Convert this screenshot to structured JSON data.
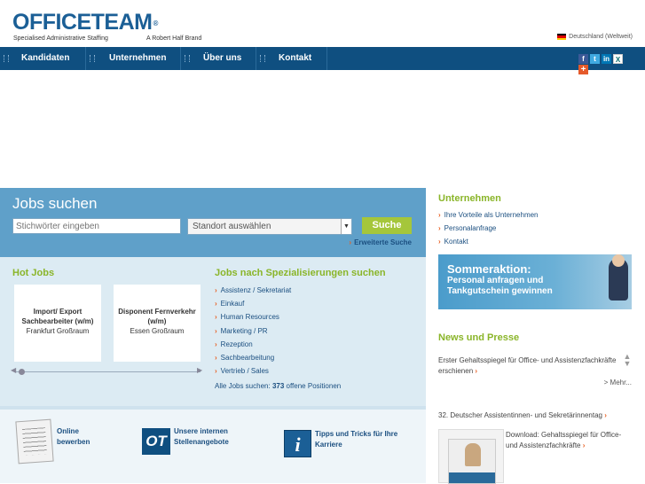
{
  "header": {
    "logo_text": "OFFICETEAM",
    "logo_mark": "®",
    "tagline": "Specialised Administrative Staffing",
    "brand": "A Robert Half Brand",
    "region": "Deutschland (Weltweit)"
  },
  "nav": {
    "items": [
      {
        "label": "Kandidaten"
      },
      {
        "label": "Unternehmen"
      },
      {
        "label": "Über uns"
      },
      {
        "label": "Kontakt"
      }
    ]
  },
  "social": {
    "icons": [
      "facebook-icon",
      "twitter-icon",
      "linkedin-icon",
      "xing-icon",
      "share-plus-icon"
    ],
    "facebook": "f",
    "twitter": "t",
    "linkedin": "in",
    "xing": "X",
    "plus": "+"
  },
  "search": {
    "title": "Jobs suchen",
    "keyword_placeholder": "Stichwörter eingeben",
    "location_value": "Standort auswählen",
    "button_label": "Suche",
    "advanced_label": "Erweiterte Suche"
  },
  "hot_jobs": {
    "title": "Hot Jobs",
    "items": [
      {
        "title": "Import/ Export Sachbearbeiter (w/m)",
        "location": "Frankfurt Großraum"
      },
      {
        "title": "Disponent Fernverkehr (w/m)",
        "location": "Essen Großraum"
      }
    ]
  },
  "specializations": {
    "title": "Jobs nach Spezialisierungen suchen",
    "items": [
      "Assistenz / Sekretariat",
      "Einkauf",
      "Human Resources",
      "Marketing / PR",
      "Rezeption",
      "Sachbearbeitung",
      "Vertrieb / Sales"
    ],
    "all_jobs_prefix": "Alle Jobs suchen:",
    "all_jobs_count": "373",
    "all_jobs_suffix": "offene Positionen"
  },
  "bottom_links": {
    "apply": "Online bewerben",
    "internal": "Unsere internen Stellenangebote",
    "tips": "Tipps und Tricks für Ihre Karriere",
    "ot_logo": "OT",
    "info_logo": "i"
  },
  "right": {
    "company_title": "Unternehmen",
    "company_links": [
      "Ihre Vorteile als Unternehmen",
      "Personalanfrage",
      "Kontakt"
    ],
    "banner_title": "Sommeraktion:",
    "banner_text": "Personal anfragen und Tankgutschein gewinnen",
    "news_title": "News und Presse",
    "news_item_1": "Erster Gehaltsspiegel für Office- und Assistenzfachkräfte erschienen",
    "more_label": "> Mehr...",
    "news_item_2": "32. Deutscher Assistentinnen- und Sekretärinnentag",
    "news_item_3": "Download: Gehaltsspiegel für Office- und Assistenzfachkräfte"
  }
}
